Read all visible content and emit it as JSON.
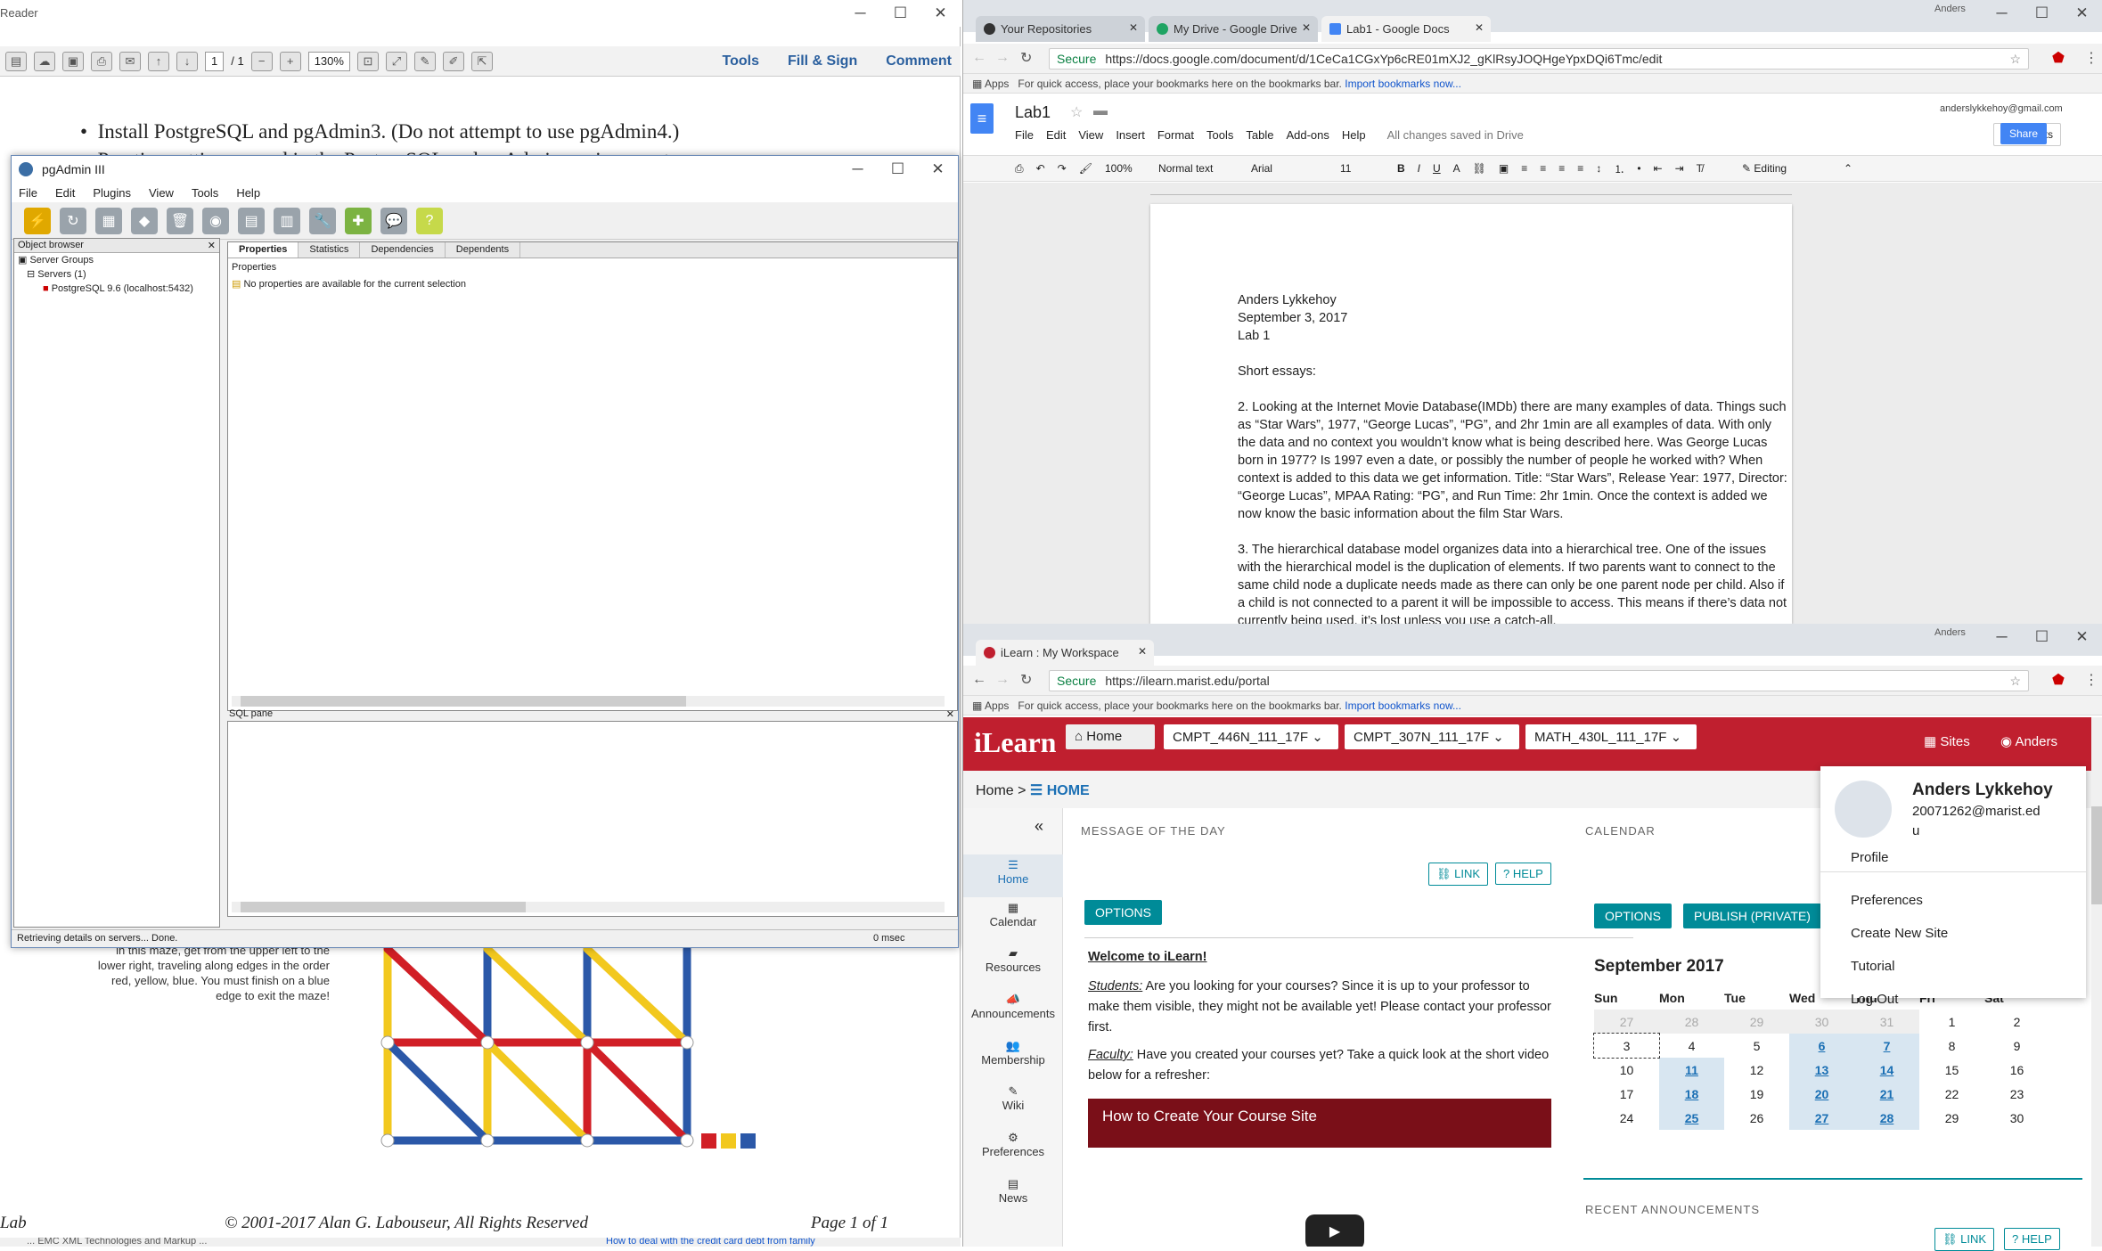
{
  "pdf": {
    "title": "Reader",
    "page_input": "1",
    "page_total": "/ 1",
    "zoom": "130%",
    "tools": "Tools",
    "fill_sign": "Fill & Sign",
    "comment": "Comment",
    "bullet_1": "Install PostgreSQL and pgAdmin3. (Do not attempt to use pgAdmin4.)",
    "bullet_2": "Practice getting around in the PostgreSQL and pgAdmin environments",
    "maze_text": "in this maze, get from the upper left to the lower right, traveling along edges in the order red, yellow, blue. You must finish on a blue edge to exit the maze!",
    "footer_left": "Lab",
    "footer_center": "© 2001-2017 Alan G. Labouseur, All Rights Reserved",
    "footer_right": "Page 1 of 1",
    "bottom_left": "... EMC XML Technologies and Markup ...",
    "bottom_link": "How to deal with the credit card debt from family"
  },
  "pgadmin": {
    "title": "pgAdmin III",
    "menu": [
      "File",
      "Edit",
      "Plugins",
      "View",
      "Tools",
      "Help"
    ],
    "object_browser": "Object browser",
    "tree": [
      "Server Groups",
      "Servers (1)",
      "PostgreSQL 9.6 (localhost:5432)"
    ],
    "tabs": [
      "Properties",
      "Statistics",
      "Dependencies",
      "Dependents"
    ],
    "props_header": "Properties",
    "props_msg": "No properties are available for the current selection",
    "sql_pane": "SQL pane",
    "status": "Retrieving details on servers... Done.",
    "timing": "0 msec"
  },
  "docs_browser": {
    "user": "Anders",
    "tabs": [
      "Your Repositories",
      "My Drive - Google Drive",
      "Lab1 - Google Docs"
    ],
    "secure": "Secure",
    "url": "https://docs.google.com/document/d/1CeCa1CGxYp6cRE01mXJ2_gKlRsyJOQHgeYpxDQi6Tmc/edit",
    "apps": "Apps",
    "bookmark_hint": "For quick access, place your bookmarks here on the bookmarks bar.",
    "import": "Import bookmarks now...",
    "doc_title": "Lab1",
    "email": "anderslykkehoy@gmail.com",
    "menu": [
      "File",
      "Edit",
      "View",
      "Insert",
      "Format",
      "Tools",
      "Table",
      "Add-ons",
      "Help"
    ],
    "saved": "All changes saved in Drive",
    "comments": "Comments",
    "share": "Share",
    "zoom": "100%",
    "style": "Normal text",
    "font": "Arial",
    "size": "11",
    "mode": "Editing",
    "doc_lines": [
      "Anders Lykkehoy",
      "September 3, 2017",
      "Lab 1",
      "",
      "Short essays:",
      "",
      "2. Looking at the Internet Movie Database(IMDb) there are many examples of data. Things such",
      "as “Star Wars”, 1977, “George Lucas”, “PG”, and 2hr 1min are all examples of data. With only",
      "the data and no context you wouldn’t know what is being described here. Was George Lucas",
      "born in 1977? Is 1997 even a date, or possibly the number of people he worked with? When",
      "context is added to this data we get information. Title: “Star Wars”, Release Year: 1977, Director:",
      "“George Lucas”, MPAA Rating: “PG”, and Run Time: 2hr 1min. Once the context is added we",
      "now know the basic information about the film Star Wars.",
      "",
      "3. The hierarchical database model organizes data into a hierarchical tree. One of the issues",
      "with the hierarchical model is the duplication of elements. If two parents want to connect to the",
      "same child node a duplicate needs made as there can only be one parent node per child. Also if",
      "a child is not connected to a parent it will be impossible to access. This means if there’s data not",
      "currently being used, it’s lost unless you use a catch-all."
    ]
  },
  "ilearn_browser": {
    "user": "Anders",
    "tab": "iLearn : My Workspace",
    "secure": "Secure",
    "url": "https://ilearn.marist.edu/portal",
    "apps": "Apps",
    "bookmark_hint": "For quick access, place your bookmarks here on the bookmarks bar.",
    "import": "Import bookmarks now...",
    "logo": "iLearn",
    "home": "Home",
    "sites": [
      "CMPT_446N_111_17F",
      "CMPT_307N_111_17F",
      "MATH_430L_111_17F"
    ],
    "sites_btn": "Sites",
    "user_btn": "Anders",
    "breadcrumb_home": "Home",
    "breadcrumb_current": "HOME",
    "side_nav": [
      "Home",
      "Calendar",
      "Resources",
      "Announcements",
      "Membership",
      "Wiki",
      "Preferences",
      "News"
    ],
    "motd_title": "MESSAGE OF THE DAY",
    "link": "LINK",
    "help": "HELP",
    "options": "OPTIONS",
    "welcome": "Welcome to iLearn!",
    "students_label": "Students:",
    "students_text": "Are you looking for your courses? Since it is up to your professor to make them visible, they might not be available yet! Please contact your professor first.",
    "faculty_label": "Faculty:",
    "faculty_text": "Have you created your courses yet? Take a quick look at the short video below for a refresher:",
    "video_title": "How to Create Your Course Site",
    "calendar_title": "CALENDAR",
    "publish": "PUBLISH (PRIVATE)",
    "month": "September 2017",
    "weekdays": [
      "Sun",
      "Mon",
      "Tue",
      "Wed",
      "Thu",
      "Fri",
      "Sat"
    ],
    "weeks": [
      [
        "27",
        "28",
        "29",
        "30",
        "31",
        "1",
        "2"
      ],
      [
        "3",
        "4",
        "5",
        "6",
        "7",
        "8",
        "9"
      ],
      [
        "10",
        "11",
        "12",
        "13",
        "14",
        "15",
        "16"
      ],
      [
        "17",
        "18",
        "19",
        "20",
        "21",
        "22",
        "23"
      ],
      [
        "24",
        "25",
        "26",
        "27",
        "28",
        "29",
        "30"
      ]
    ],
    "recent": "RECENT ANNOUNCEMENTS",
    "profile_name": "Anders Lykkehoy",
    "profile_id": "20071262@marist.ed",
    "profile_id2": "u",
    "profile_menu": [
      "Profile",
      "Preferences",
      "Create New Site",
      "Tutorial",
      "Log Out"
    ]
  }
}
